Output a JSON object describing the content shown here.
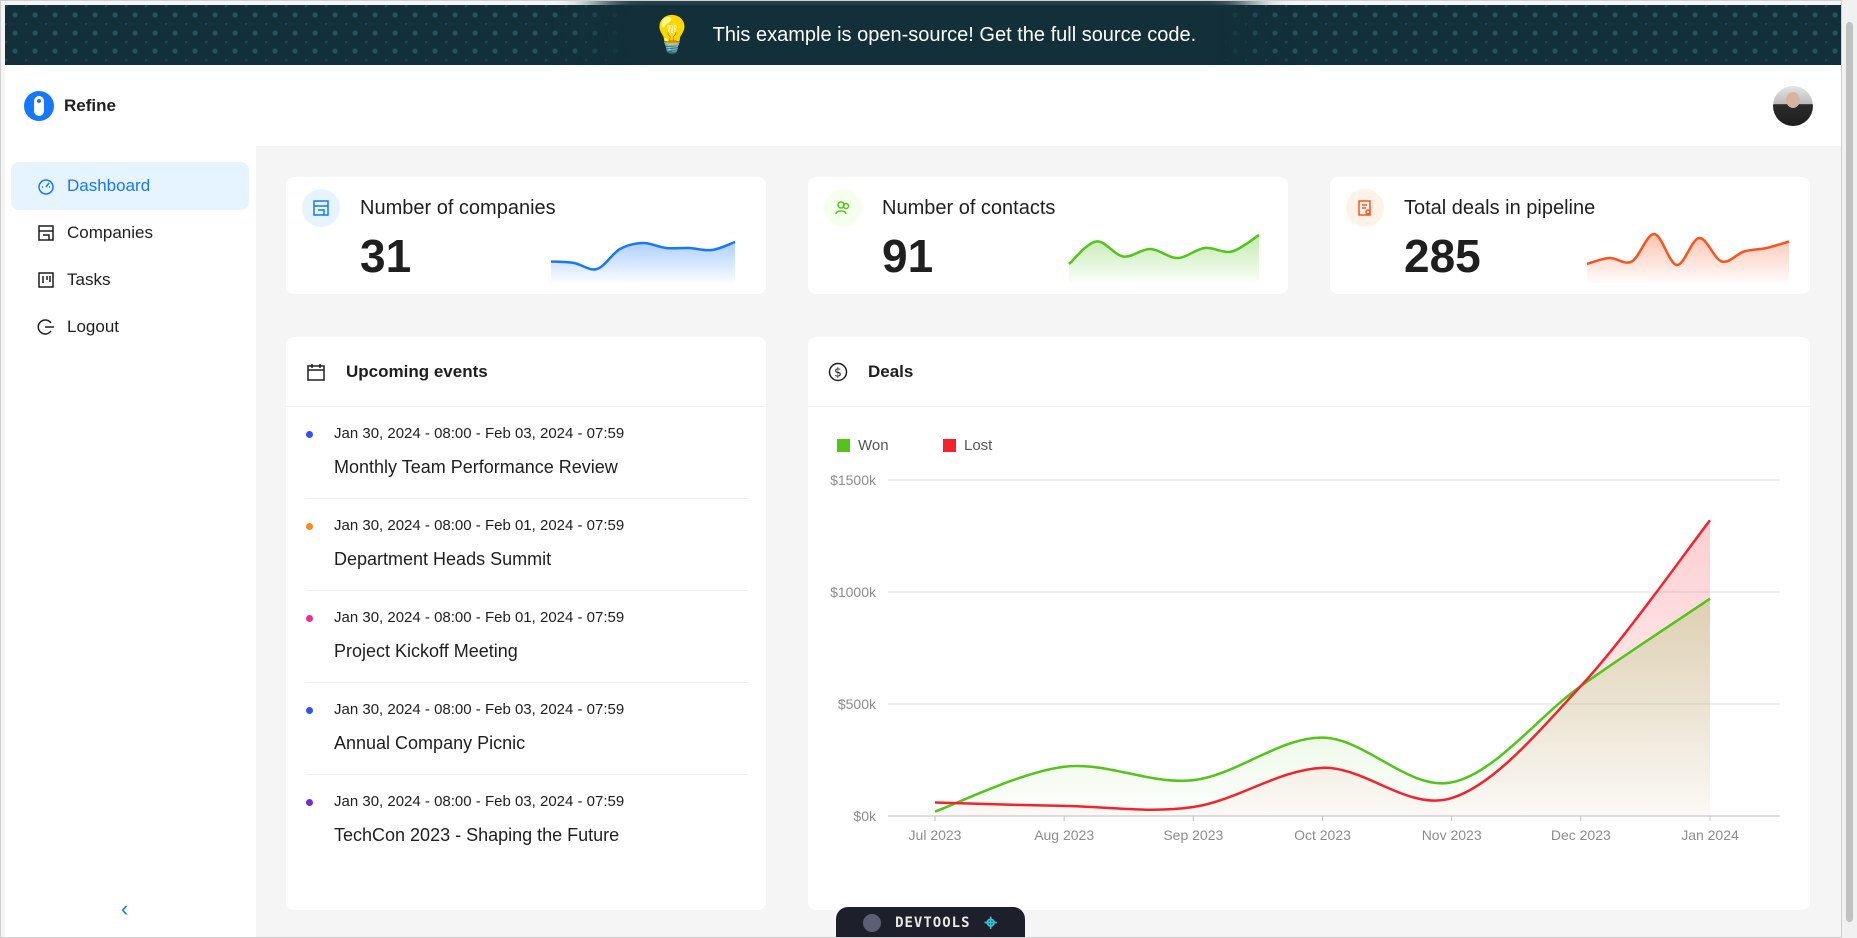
{
  "banner": {
    "icon": "lightbulb-icon",
    "text": "This example is open-source! Get the full source code."
  },
  "app": {
    "name": "Refine"
  },
  "sidebar": {
    "items": [
      {
        "label": "Dashboard",
        "icon": "dashboard-icon",
        "active": true
      },
      {
        "label": "Companies",
        "icon": "shop-icon",
        "active": false
      },
      {
        "label": "Tasks",
        "icon": "project-icon",
        "active": false
      },
      {
        "label": "Logout",
        "icon": "logout-icon",
        "active": false
      }
    ],
    "collapse_icon": "chevron-left-icon"
  },
  "kpis": [
    {
      "title": "Number of companies",
      "value": "31",
      "color": "#1677ff",
      "icon_bg": "#e6f4ff",
      "trend": [
        0.35,
        0.32,
        0.2,
        0.6,
        0.72,
        0.62,
        0.62,
        0.58,
        0.74
      ]
    },
    {
      "title": "Number of contacts",
      "value": "91",
      "color": "#52c41a",
      "icon_bg": "#f6ffed",
      "trend": [
        0.3,
        0.75,
        0.45,
        0.6,
        0.42,
        0.62,
        0.55,
        0.88
      ]
    },
    {
      "title": "Total deals in pipeline",
      "value": "285",
      "color": "#fa541c",
      "icon_bg": "#fff2e8",
      "trend": [
        0.3,
        0.42,
        0.35,
        0.9,
        0.28,
        0.82,
        0.35,
        0.55,
        0.62,
        0.75
      ]
    }
  ],
  "events": {
    "title": "Upcoming events",
    "items": [
      {
        "date": "Jan 30, 2024 - 08:00 - Feb 03, 2024 - 07:59",
        "title": "Monthly Team Performance Review",
        "color": "#2f54eb"
      },
      {
        "date": "Jan 30, 2024 - 08:00 - Feb 01, 2024 - 07:59",
        "title": "Department Heads Summit",
        "color": "#fa8c16"
      },
      {
        "date": "Jan 30, 2024 - 08:00 - Feb 01, 2024 - 07:59",
        "title": "Project Kickoff Meeting",
        "color": "#eb2f96"
      },
      {
        "date": "Jan 30, 2024 - 08:00 - Feb 03, 2024 - 07:59",
        "title": "Annual Company Picnic",
        "color": "#2f54eb"
      },
      {
        "date": "Jan 30, 2024 - 08:00 - Feb 03, 2024 - 07:59",
        "title": "TechCon 2023 - Shaping the Future",
        "color": "#722ed1"
      }
    ]
  },
  "deals": {
    "title": "Deals",
    "legend": {
      "won": "Won",
      "lost": "Lost"
    },
    "colors": {
      "won": "#52c41a",
      "lost": "#f5222d"
    }
  },
  "chart_data": {
    "type": "area",
    "title": "Deals",
    "categories": [
      "Jul 2023",
      "Aug 2023",
      "Sep 2023",
      "Oct 2023",
      "Nov 2023",
      "Dec 2023",
      "Jan 2024"
    ],
    "series": [
      {
        "name": "Won",
        "values": [
          20,
          220,
          160,
          350,
          150,
          580,
          970
        ]
      },
      {
        "name": "Lost",
        "values": [
          60,
          45,
          40,
          215,
          80,
          580,
          1320
        ]
      }
    ],
    "yticks": [
      "$0k",
      "$500k",
      "$1000k",
      "$1500k"
    ],
    "ylim": [
      0,
      1500
    ],
    "grid": true,
    "legend": "top-left"
  },
  "devtools": {
    "label": "DEVTOOLS"
  }
}
